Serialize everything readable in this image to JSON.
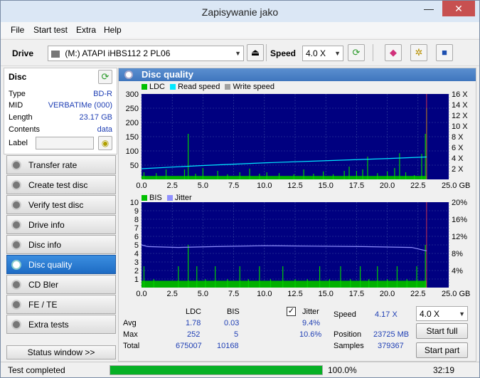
{
  "window": {
    "title": "Zapisywanie jako",
    "minimize": "—",
    "close": "✕"
  },
  "menu": [
    "File",
    "Start test",
    "Extra",
    "Help"
  ],
  "toolbar": {
    "drive_label": "Drive",
    "drive_value": "(M:)   ATAPI iHBS112   2 PL06",
    "speed_label": "Speed",
    "speed_value": "4.0 X"
  },
  "disc": {
    "title": "Disc",
    "rows": [
      {
        "label": "Type",
        "value": "BD-R"
      },
      {
        "label": "MID",
        "value": "VERBATIMe (000)"
      },
      {
        "label": "Length",
        "value": "23.17 GB"
      },
      {
        "label": "Contents",
        "value": "data"
      }
    ],
    "label_field": "Label"
  },
  "nav": [
    "Transfer rate",
    "Create test disc",
    "Verify test disc",
    "Drive info",
    "Disc info",
    "Disc quality",
    "CD Bler",
    "FE / TE",
    "Extra tests"
  ],
  "nav_active_index": 5,
  "status_window_button": "Status window >>",
  "main_title": "Disc quality",
  "chart_data": [
    {
      "type": "area",
      "legend": [
        "LDC",
        "Read speed",
        "Write speed"
      ],
      "legend_colors": [
        "#00c000",
        "#00e8ff",
        "#a0a0a0"
      ],
      "x_ticks": [
        "0.0",
        "2.5",
        "5.0",
        "7.5",
        "10.0",
        "12.5",
        "15.0",
        "17.5",
        "20.0",
        "22.5",
        "25.0 GB"
      ],
      "y_ticks_left": [
        "300",
        "250",
        "200",
        "150",
        "100",
        "50"
      ],
      "y_ticks_right": [
        "16 X",
        "14 X",
        "12 X",
        "10 X",
        "8 X",
        "6 X",
        "4 X",
        "2 X"
      ],
      "xlim": [
        0,
        25
      ],
      "ylim": [
        0,
        300
      ],
      "ldc_spikes": [
        [
          0.2,
          25
        ],
        [
          1.2,
          22
        ],
        [
          2.0,
          35
        ],
        [
          3.5,
          35
        ],
        [
          3.8,
          160
        ],
        [
          4.4,
          20
        ],
        [
          5.0,
          40
        ],
        [
          6.2,
          30
        ],
        [
          7.0,
          18
        ],
        [
          8.0,
          25
        ],
        [
          8.8,
          38
        ],
        [
          9.6,
          20
        ],
        [
          10.2,
          25
        ],
        [
          11.2,
          22
        ],
        [
          12.4,
          18
        ],
        [
          13.2,
          35
        ],
        [
          14.0,
          20
        ],
        [
          14.8,
          28
        ],
        [
          15.6,
          18
        ],
        [
          16.5,
          30
        ],
        [
          16.9,
          45
        ],
        [
          17.5,
          30
        ],
        [
          18.0,
          35
        ],
        [
          18.4,
          80
        ],
        [
          19.2,
          22
        ],
        [
          20.0,
          28
        ],
        [
          20.6,
          40
        ],
        [
          21.0,
          92
        ],
        [
          21.5,
          25
        ],
        [
          22.2,
          15
        ],
        [
          22.8,
          90
        ],
        [
          23.1,
          160
        ],
        [
          23.2,
          250
        ]
      ],
      "ldc_base": 12,
      "read_speed": [
        [
          0,
          2.0
        ],
        [
          5,
          2.6
        ],
        [
          10,
          3.1
        ],
        [
          15,
          3.5
        ],
        [
          20,
          3.9
        ],
        [
          23.2,
          4.2
        ]
      ]
    },
    {
      "type": "area",
      "legend": [
        "BIS",
        "Jitter"
      ],
      "legend_colors": [
        "#00c000",
        "#9090ff"
      ],
      "x_ticks": [
        "0.0",
        "2.5",
        "5.0",
        "7.5",
        "10.0",
        "12.5",
        "15.0",
        "17.5",
        "20.0",
        "22.5",
        "25.0 GB"
      ],
      "y_ticks_left": [
        "10",
        "9",
        "8",
        "7",
        "6",
        "5",
        "4",
        "3",
        "2",
        "1"
      ],
      "y_ticks_right": [
        "20%",
        "16%",
        "12%",
        "8%",
        "4%"
      ],
      "xlim": [
        0,
        25
      ],
      "ylim": [
        0,
        10
      ],
      "bis_spikes": [
        [
          0.2,
          2.5
        ],
        [
          1.0,
          1
        ],
        [
          3.0,
          2.5
        ],
        [
          3.8,
          5
        ],
        [
          4.5,
          2.5
        ],
        [
          5.2,
          1
        ],
        [
          6.0,
          2.5
        ],
        [
          7.0,
          1
        ],
        [
          8.0,
          2.5
        ],
        [
          8.7,
          1
        ],
        [
          9.6,
          2.5
        ],
        [
          10.5,
          1
        ],
        [
          11.5,
          2.5
        ],
        [
          12.5,
          1
        ],
        [
          13.5,
          1
        ],
        [
          14.5,
          2.5
        ],
        [
          15.3,
          1
        ],
        [
          16.2,
          2.5
        ],
        [
          17.0,
          1
        ],
        [
          17.8,
          2.5
        ],
        [
          18.5,
          1
        ],
        [
          19.2,
          2.5
        ],
        [
          20.0,
          1
        ],
        [
          20.8,
          2.5
        ],
        [
          21.6,
          1
        ],
        [
          22.4,
          2.5
        ],
        [
          23.1,
          5
        ]
      ],
      "bis_base": 0.8,
      "jitter": [
        [
          0,
          5.0
        ],
        [
          0.5,
          4.8
        ],
        [
          3,
          4.7
        ],
        [
          6,
          4.8
        ],
        [
          10,
          4.9
        ],
        [
          14,
          4.85
        ],
        [
          18,
          4.8
        ],
        [
          22,
          4.7
        ],
        [
          23.2,
          4.3
        ]
      ]
    }
  ],
  "stats": {
    "col_ldc": "LDC",
    "col_bis": "BIS",
    "col_jitter": "Jitter",
    "rows": [
      {
        "label": "Avg",
        "ldc": "1.78",
        "bis": "0.03",
        "jitter": "9.4%"
      },
      {
        "label": "Max",
        "ldc": "252",
        "bis": "5",
        "jitter": "10.6%"
      },
      {
        "label": "Total",
        "ldc": "675007",
        "bis": "10168",
        "jitter": ""
      }
    ],
    "jitter_checked": true,
    "speed_label": "Speed",
    "speed_value": "4.17 X",
    "position_label": "Position",
    "position_value": "23725 MB",
    "samples_label": "Samples",
    "samples_value": "379367",
    "speed_select": "4.0 X",
    "start_full": "Start full",
    "start_part": "Start part"
  },
  "status": {
    "text": "Test completed",
    "progress": 100,
    "percent": "100.0%",
    "time": "32:19"
  }
}
